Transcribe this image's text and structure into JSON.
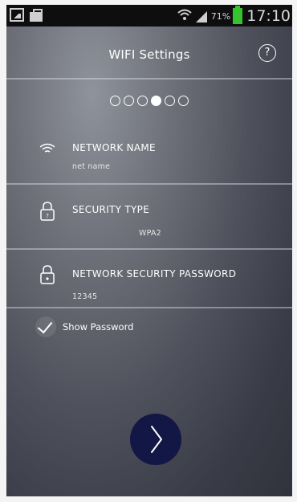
{
  "status_bar": {
    "battery_percent": "71%",
    "time": "17:10"
  },
  "header": {
    "title": "WIFI Settings",
    "help_glyph": "?"
  },
  "stepper": {
    "total": 6,
    "current": 4
  },
  "fields": {
    "network_name": {
      "label": "NETWORK NAME",
      "value": "net name",
      "icon": "wifi-icon"
    },
    "security_type": {
      "label": "SECURITY TYPE",
      "value": "WPA2",
      "icon": "lock-icon"
    },
    "password": {
      "label": "NETWORK SECURITY PASSWORD",
      "value": "12345",
      "icon": "lock-icon"
    }
  },
  "show_password": {
    "label": "Show Password",
    "checked": true
  },
  "colors": {
    "next_button": "#121746",
    "battery": "#37c22f"
  }
}
